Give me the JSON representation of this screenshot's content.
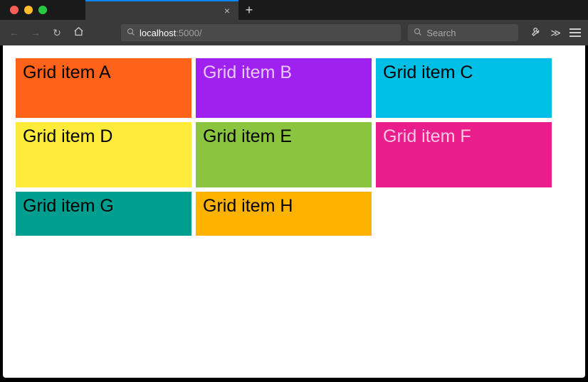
{
  "browser": {
    "url_host": "localhost",
    "url_rest": ":5000/",
    "search_placeholder": "Search",
    "tab_close_glyph": "×",
    "newtab_glyph": "+"
  },
  "page": {
    "grid_items": [
      {
        "label": "Grid item A"
      },
      {
        "label": "Grid item B"
      },
      {
        "label": "Grid item C"
      },
      {
        "label": "Grid item D"
      },
      {
        "label": "Grid item E"
      },
      {
        "label": "Grid item F"
      },
      {
        "label": "Grid item G"
      },
      {
        "label": "Grid item H"
      }
    ]
  },
  "colors": {
    "a": "#ff6319",
    "b": "#a020f0",
    "c": "#00bfe6",
    "d": "#ffeb3b",
    "e": "#8bc53f",
    "f": "#e91e8c",
    "g": "#009e8e",
    "h": "#ffb300"
  }
}
